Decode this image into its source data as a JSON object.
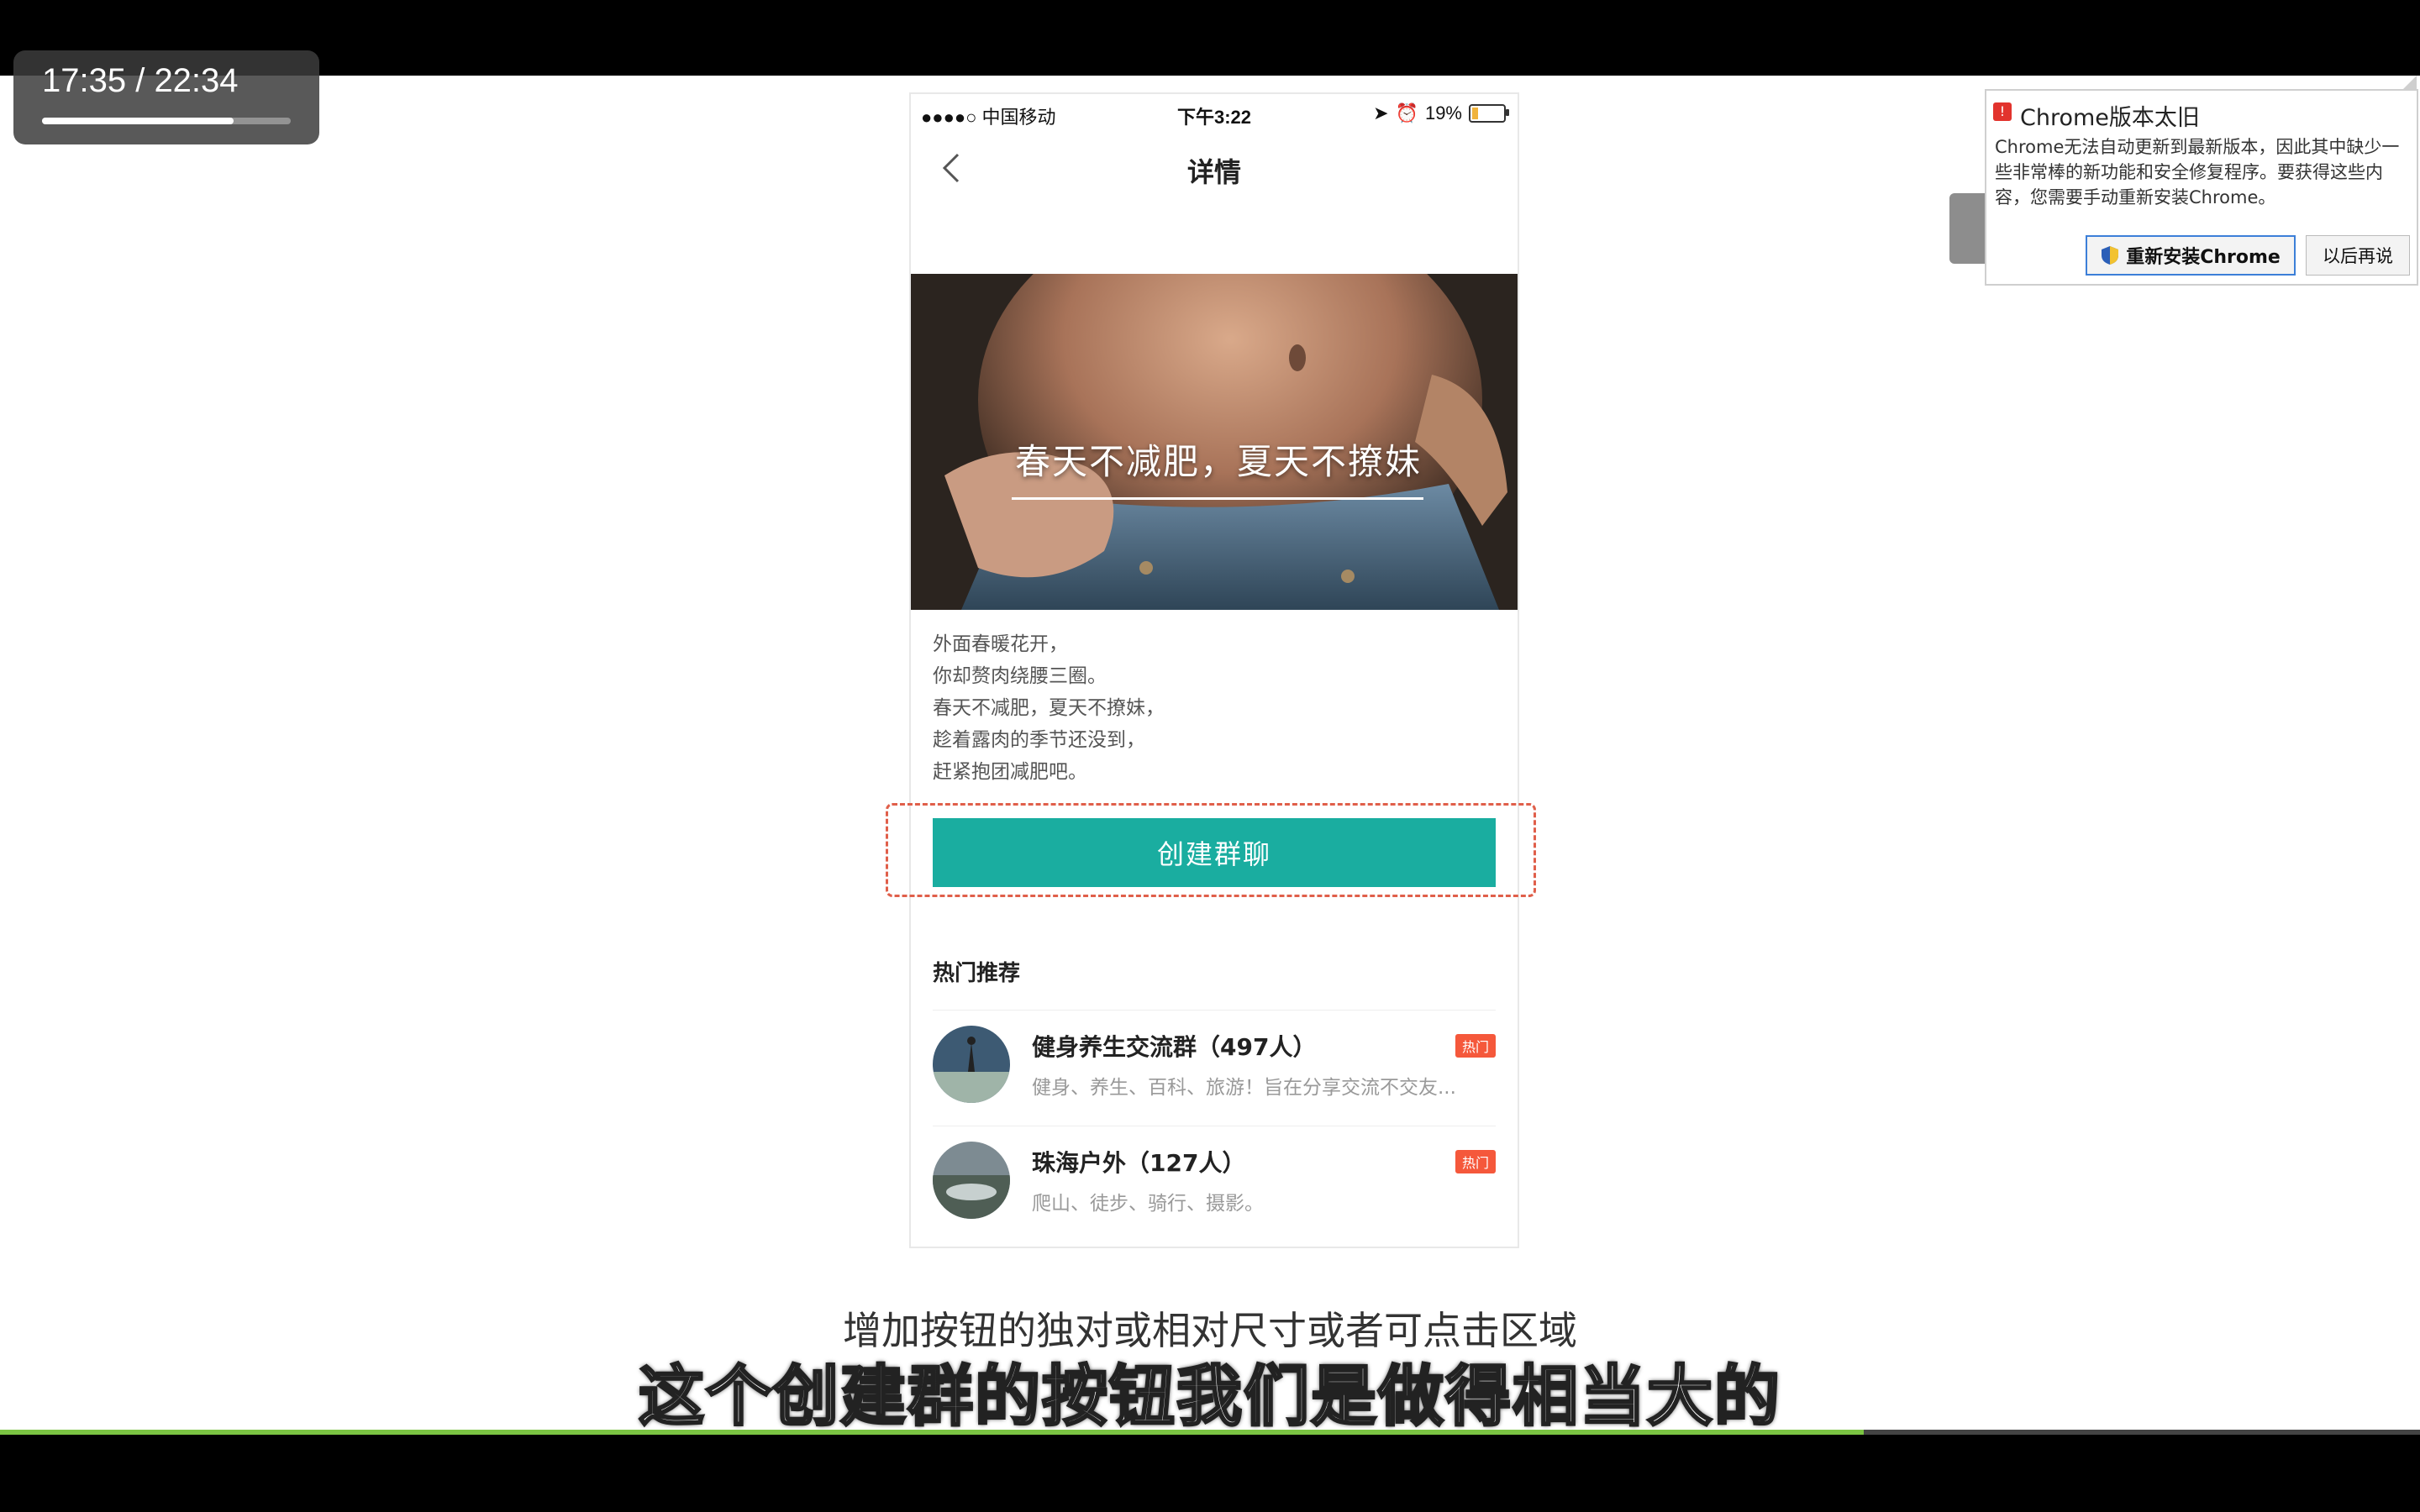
{
  "player": {
    "time": "17:35 / 22:34",
    "overlay_progress": 0.77,
    "bottom_progress": 0.77,
    "subtitle_small": "增加按钮的独对或相对尺寸或者可点击区域",
    "subtitle_big": "这个创建群的按钮我们是做得相当大的"
  },
  "phone": {
    "status": {
      "carrier": "●●●●○ 中国移动",
      "time": "下午3:22",
      "battery": "19%",
      "battery_level": 0.19
    },
    "nav_title": "详情",
    "hero_slogan": "春天不减肥，夏天不撩妹",
    "description": [
      "外面春暖花开，",
      "你却赘肉绕腰三圈。",
      "春天不减肥，夏天不撩妹，",
      "趁着露肉的季节还没到，",
      "赶紧抱团减肥吧。"
    ],
    "cta_label": "创建群聊",
    "section_title": "热门推荐",
    "groups": [
      {
        "title": "健身养生交流群（497人）",
        "subtitle": "健身、养生、百科、旅游！旨在分享交流不交友...",
        "badge": "热门"
      },
      {
        "title": "珠海户外（127人）",
        "subtitle": "爬山、徒步、骑行、摄影。",
        "badge": "热门"
      }
    ],
    "colors": {
      "cta": "#1aada0",
      "badge": "#f5583b",
      "highlight": "#e05f4a"
    }
  },
  "chrome_notice": {
    "title": "Chrome版本太旧",
    "body": "Chrome无法自动更新到最新版本，因此其中缺少一些非常棒的新功能和安全修复程序。要获得这些内容，您需要手动重新安装Chrome。",
    "reinstall_label": "重新安装Chrome",
    "later_label": "以后再说"
  }
}
